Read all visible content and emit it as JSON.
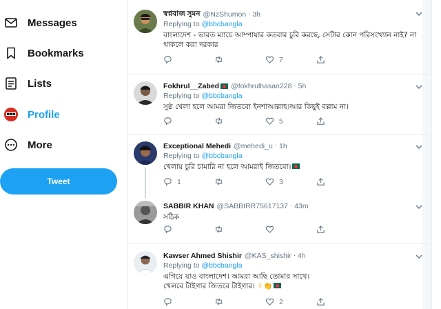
{
  "sidebar": {
    "items": [
      {
        "label": "Messages",
        "icon": "envelope-icon"
      },
      {
        "label": "Bookmarks",
        "icon": "bookmark-icon"
      },
      {
        "label": "Lists",
        "icon": "list-icon"
      },
      {
        "label": "Profile",
        "icon": "avatar-icon"
      },
      {
        "label": "More",
        "icon": "more-icon"
      }
    ],
    "tweet_button": "Tweet"
  },
  "colors": {
    "accent": "#1da1f2",
    "text": "#14171a",
    "muted": "#657786",
    "border": "#e6ecf0"
  },
  "tweets": [
    {
      "name": "স্বপ্নবাজ সুমন",
      "handle": "@NzShumon",
      "time": "3h",
      "reply_prefix": "Replying to",
      "reply_to": "@bbcbangla",
      "text": "বাংলাদেশ - ভারত ম্যাচে আম্পায়ার কতবার চুরি করছে, সেটার কোন পরিসংখ্যান নাই? না থাকলে করা দরকার",
      "replies": "",
      "retweets": "",
      "likes": "7"
    },
    {
      "name": "Fokhrul__Zabed",
      "handle": "@fokhrulhasan228",
      "time": "5h",
      "reply_prefix": "Replying to",
      "reply_to": "@bbcbangla",
      "text": "সুষ্ঠ খেলা হলে আমরা জিতবো ইনশাআল্লাহ।আর কিছুই বল্লাম না।",
      "replies": "",
      "retweets": "",
      "likes": "5"
    },
    {
      "name": "Exceptional Mehedi",
      "handle": "@mehedi_u",
      "time": "1h",
      "reply_prefix": "Replying to",
      "reply_to": "@bbcbangla",
      "text": "খেলায় চুরি চামারি না হলে আমরাই জিতবো।",
      "replies": "1",
      "retweets": "",
      "likes": "3"
    },
    {
      "name": "SABBIR KHAN",
      "handle": "@SABBIRR75617137",
      "time": "43m",
      "text": "সঠিক",
      "replies": "",
      "retweets": "",
      "likes": ""
    },
    {
      "name": "Kawser Ahmed Shishir",
      "handle": "@KAS_shishir",
      "time": "4h",
      "reply_prefix": "Replying to",
      "reply_to": "@bbcbangla",
      "text_line1": "এগিয়ে যাও বাংলাদেশ। আমরা আছি তোমার সাথে।",
      "text_line2": "খেলবে টাইগার জিতবে টাইগার।",
      "replies": "",
      "retweets": "",
      "likes": "2"
    }
  ]
}
